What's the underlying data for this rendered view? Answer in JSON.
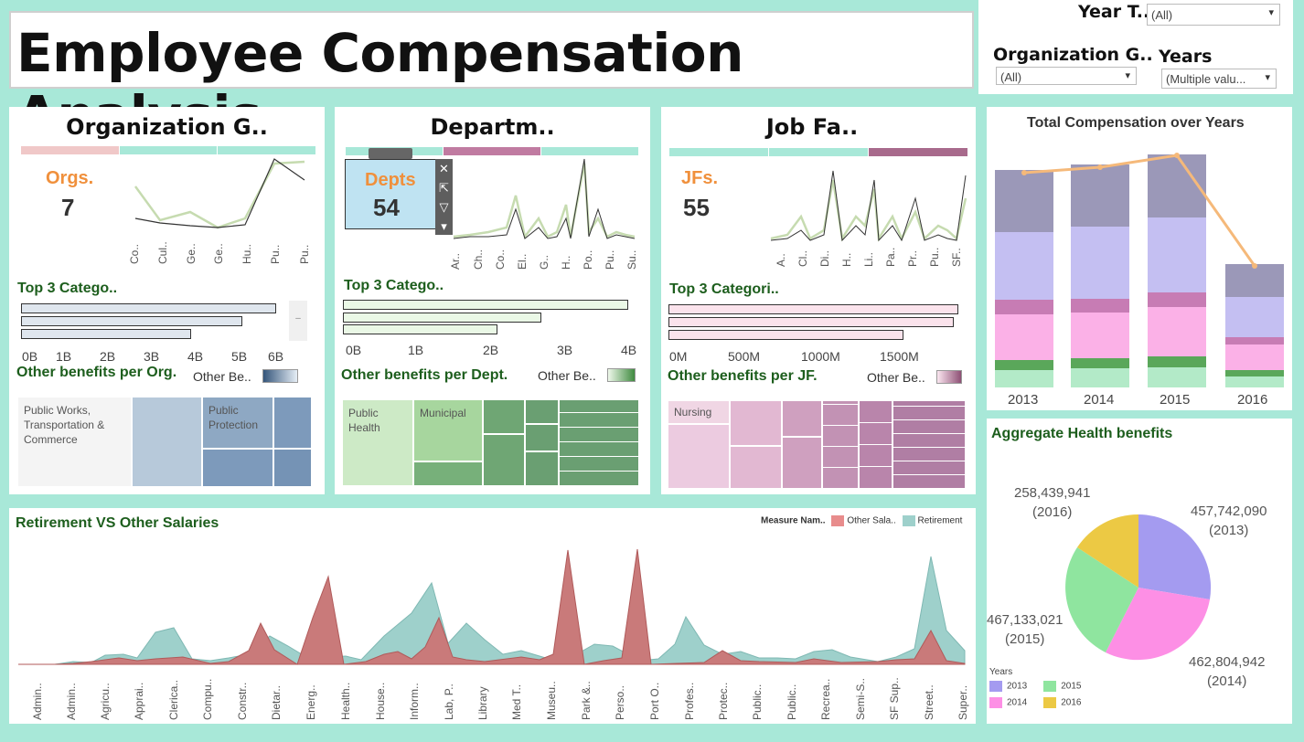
{
  "header": {
    "title": "Employee Compensation Analysis"
  },
  "filters": {
    "year_type": {
      "label": "Year T..",
      "value": "(All)"
    },
    "org_group": {
      "label": "Organization G..",
      "value": "(All)"
    },
    "years": {
      "label": "Years",
      "value": "(Multiple valu..."
    }
  },
  "org_panel": {
    "title": "Organization G..",
    "kpi_label": "Orgs.",
    "kpi_value": "7",
    "x_labels": [
      "Co..",
      "Cul..",
      "Ge..",
      "Ge..",
      "Hu..",
      "Pu..",
      "Pu.."
    ],
    "top3_title": "Top 3 Catego..",
    "ticks": [
      "0B",
      "1B",
      "2B",
      "3B",
      "4B",
      "5B",
      "6B"
    ],
    "benefits_title": "Other benefits per Org.",
    "legend_label": "Other Be..",
    "scroll_glyph": "–",
    "treemap_labels": [
      "Public Works, Transportation & Commerce",
      "Public Protection"
    ]
  },
  "dept_panel": {
    "title": "Departm..",
    "kpi_label": "Depts",
    "kpi_value": "54",
    "x_labels": [
      "Ar..",
      "Ch..",
      "Co..",
      "El..",
      "G..",
      "H..",
      "Po..",
      "Pu..",
      "Su.."
    ],
    "top3_title": "Top 3 Catego..",
    "ticks": [
      "0B",
      "1B",
      "2B",
      "3B",
      "4B"
    ],
    "benefits_title": "Other benefits per Dept.",
    "legend_label": "Other Be..",
    "treemap_labels": [
      "Public Health",
      "Municipal"
    ]
  },
  "jf_panel": {
    "title": "Job Fa..",
    "kpi_label": "JFs.",
    "kpi_value": "55",
    "x_labels": [
      "A..",
      "Cl..",
      "Di..",
      "H..",
      "Li..",
      "Pa..",
      "Pr..",
      "Pu..",
      "SF.."
    ],
    "top3_title": "Top 3 Categori..",
    "ticks": [
      "0M",
      "500M",
      "1000M",
      "1500M"
    ],
    "benefits_title": "Other benefits per JF.",
    "legend_label": "Other Be..",
    "treemap_labels": [
      "Nursing"
    ]
  },
  "comp_panel": {
    "title": "Total Compensation over Years",
    "years": [
      "2013",
      "2014",
      "2015",
      "2016"
    ]
  },
  "retire_panel": {
    "title": "Retirement VS Other Salaries",
    "legend_title": "Measure Nam..",
    "legend_items": [
      "Other Sala..",
      "Retirement"
    ],
    "x_labels": [
      "Admin..",
      "Admin..",
      "Agricu..",
      "Apprai..",
      "Clerica..",
      "Compu..",
      "Constr..",
      "Dietar..",
      "Energ..",
      "Health..",
      "House..",
      "Inform..",
      "Lab, P..",
      "Library",
      "Med T..",
      "Museu..",
      "Park &..",
      "Perso..",
      "Port O..",
      "Profes..",
      "Protec..",
      "Public..",
      "Public..",
      "Recrea..",
      "Semi-S..",
      "SF Sup..",
      "Street..",
      "Super.."
    ]
  },
  "health_panel": {
    "title": "Aggregate Health benefits",
    "legend_title": "Years",
    "slices": [
      {
        "year": "2013",
        "value": "457,742,090",
        "color": "#a49bf0"
      },
      {
        "year": "2014",
        "value": "462,804,942",
        "color": "#fd8fe5"
      },
      {
        "year": "2015",
        "value": "467,133,021",
        "color": "#8fe59f"
      },
      {
        "year": "2016",
        "value": "258,439,941",
        "color": "#ecc944"
      }
    ]
  },
  "colors": {
    "background": "#a8e8d8",
    "accent_orange": "#f0903c",
    "accent_green": "#1d5e1d"
  },
  "tooltip_icons": [
    "close-icon",
    "open-external-icon",
    "filter-icon",
    "dropdown-arrow-icon"
  ]
}
